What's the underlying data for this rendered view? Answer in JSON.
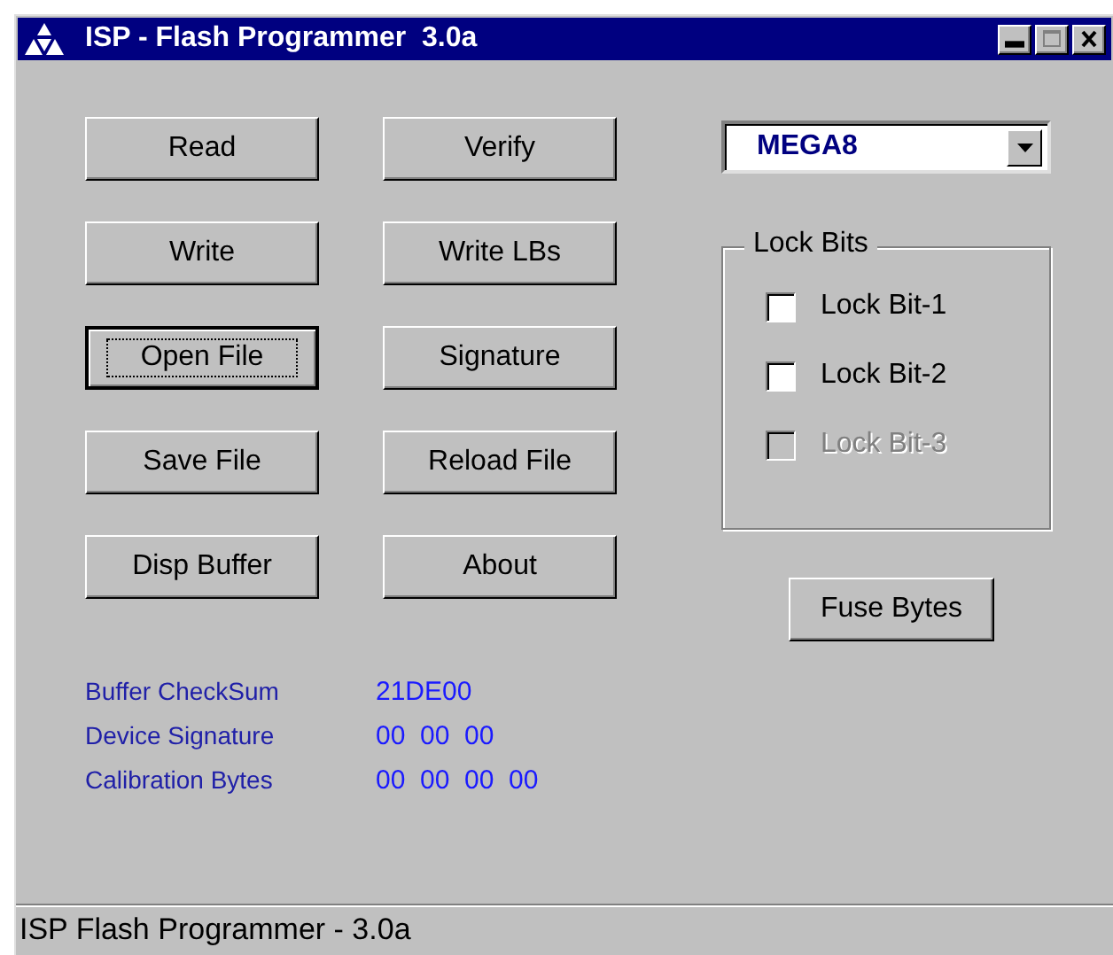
{
  "window": {
    "title": "ISP - Flash Programmer  3.0a"
  },
  "buttons": [
    {
      "label": "Read",
      "focused": false
    },
    {
      "label": "Verify",
      "focused": false
    },
    {
      "label": "Write",
      "focused": false
    },
    {
      "label": "Write LBs",
      "focused": false
    },
    {
      "label": "Open File",
      "focused": true
    },
    {
      "label": "Signature",
      "focused": false
    },
    {
      "label": "Save File",
      "focused": false
    },
    {
      "label": "Reload File",
      "focused": false
    },
    {
      "label": "Disp Buffer",
      "focused": false
    },
    {
      "label": "About",
      "focused": false
    }
  ],
  "device_select": {
    "value": "MEGA8"
  },
  "lock_bits": {
    "title": "Lock Bits",
    "items": [
      {
        "label": "Lock Bit-1",
        "checked": false,
        "disabled": false
      },
      {
        "label": "Lock Bit-2",
        "checked": false,
        "disabled": false
      },
      {
        "label": "Lock Bit-3",
        "checked": false,
        "disabled": true
      }
    ]
  },
  "fuse_button": {
    "label": "Fuse Bytes"
  },
  "info": [
    {
      "label": "Buffer CheckSum",
      "value": "21DE00"
    },
    {
      "label": "Device Signature",
      "value": "00  00  00"
    },
    {
      "label": "Calibration Bytes",
      "value": "00  00  00  00"
    }
  ],
  "status_bar": {
    "text": "ISP Flash Programmer - 3.0a"
  }
}
